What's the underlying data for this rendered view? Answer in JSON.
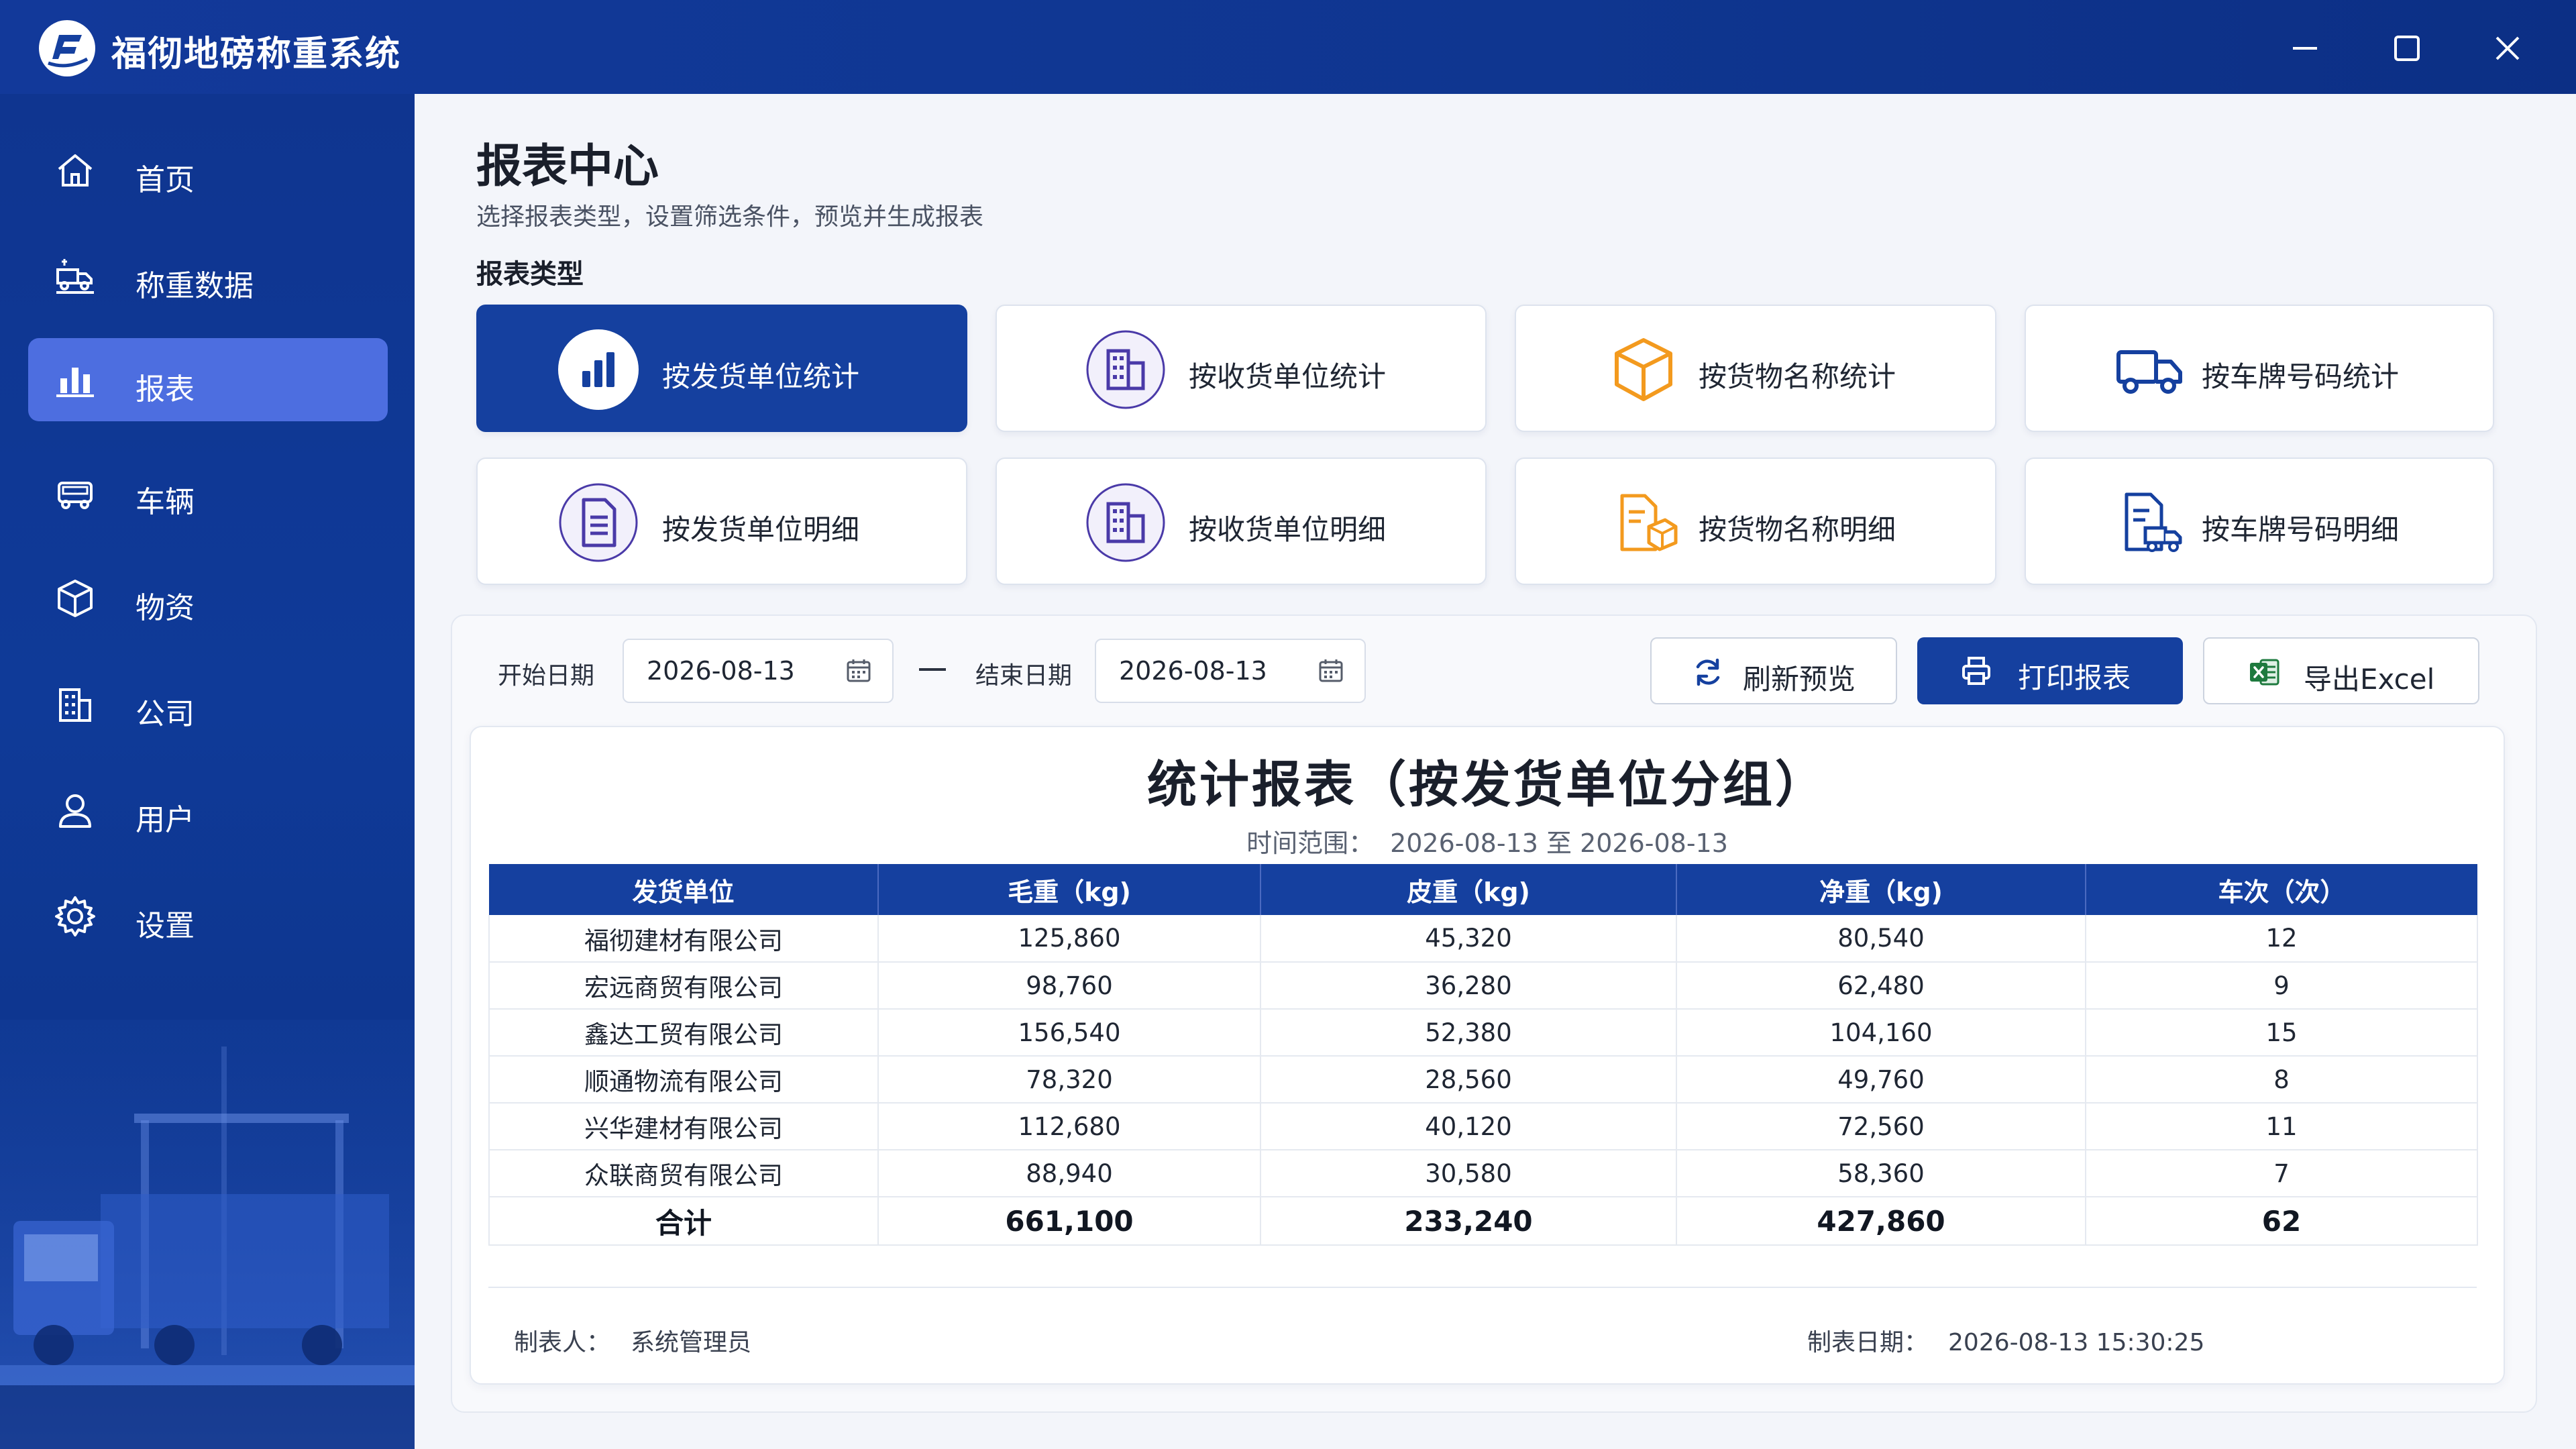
{
  "app": {
    "title": "福彻地磅称重系统"
  },
  "sidebar": {
    "items": [
      {
        "label": "首页",
        "icon": "home-icon",
        "active": false
      },
      {
        "label": "称重数据",
        "icon": "truck-scale-icon",
        "active": false
      },
      {
        "label": "报表",
        "icon": "bar-chart-icon",
        "active": true
      },
      {
        "label": "车辆",
        "icon": "vehicle-icon",
        "active": false
      },
      {
        "label": "物资",
        "icon": "cube-icon",
        "active": false
      },
      {
        "label": "公司",
        "icon": "building-icon",
        "active": false
      },
      {
        "label": "用户",
        "icon": "user-icon",
        "active": false
      },
      {
        "label": "设置",
        "icon": "gear-icon",
        "active": false
      }
    ]
  },
  "page": {
    "title": "报表中心",
    "subtitle": "选择报表类型，设置筛选条件，预览并生成报表",
    "section_label": "报表类型"
  },
  "report_types": [
    {
      "label": "按发货单位统计",
      "icon": "bar-chart-circle-icon",
      "active": true
    },
    {
      "label": "按收货单位统计",
      "icon": "building-circle-icon",
      "active": false
    },
    {
      "label": "按货物名称统计",
      "icon": "box-icon",
      "active": false
    },
    {
      "label": "按车牌号码统计",
      "icon": "truck-icon",
      "active": false
    },
    {
      "label": "按发货单位明细",
      "icon": "document-circle-icon",
      "active": false
    },
    {
      "label": "按收货单位明细",
      "icon": "building-circle-icon",
      "active": false
    },
    {
      "label": "按货物名称明细",
      "icon": "document-box-icon",
      "active": false
    },
    {
      "label": "按车牌号码明细",
      "icon": "document-truck-icon",
      "active": false
    }
  ],
  "filters": {
    "start_label": "开始日期",
    "start_value": "2026-08-13",
    "end_label": "结束日期",
    "end_value": "2026-08-13",
    "dash": "—"
  },
  "toolbar": {
    "refresh_label": "刷新预览",
    "print_label": "打印报表",
    "export_label": "导出Excel"
  },
  "report": {
    "title": "统计报表（按发货单位分组）",
    "range_label": "时间范围：",
    "range_value": "2026-08-13 至 2026-08-13",
    "columns": [
      "发货单位",
      "毛重（kg)",
      "皮重（kg)",
      "净重（kg)",
      "车次（次）"
    ],
    "rows": [
      [
        "福彻建材有限公司",
        "125,860",
        "45,320",
        "80,540",
        "12"
      ],
      [
        "宏远商贸有限公司",
        "98,760",
        "36,280",
        "62,480",
        "9"
      ],
      [
        "鑫达工贸有限公司",
        "156,540",
        "52,380",
        "104,160",
        "15"
      ],
      [
        "顺通物流有限公司",
        "78,320",
        "28,560",
        "49,760",
        "8"
      ],
      [
        "兴华建材有限公司",
        "112,680",
        "40,120",
        "72,560",
        "11"
      ],
      [
        "众联商贸有限公司",
        "88,940",
        "30,580",
        "58,360",
        "7"
      ]
    ],
    "total": [
      "合计",
      "661,100",
      "233,240",
      "427,860",
      "62"
    ],
    "maker_label": "制表人：",
    "maker_value": "系统管理员",
    "date_label": "制表日期：",
    "date_value": "2026-08-13 15:30:25"
  },
  "colors": {
    "primary": "#15409f",
    "sidebar": "#0f3590",
    "active_nav": "#4d6ee0",
    "accent_orange": "#f39a1e",
    "accent_purple": "#4a3aa8",
    "excel_green": "#1e7a3e"
  }
}
